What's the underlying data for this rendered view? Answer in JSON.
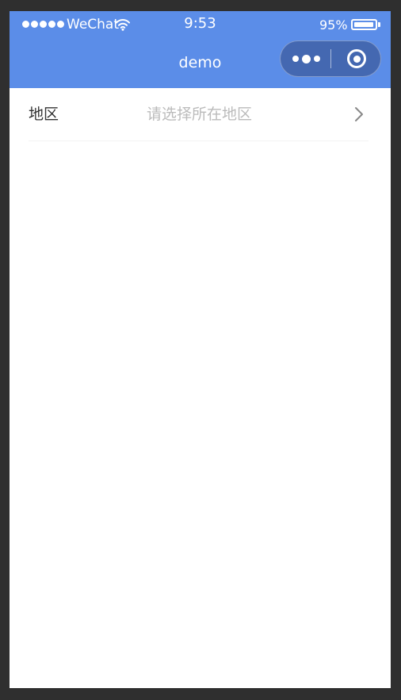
{
  "status_bar": {
    "carrier": "WeChat",
    "time": "9:53",
    "battery_percent": "95%",
    "battery_level": 0.95,
    "signal_dots": 5
  },
  "nav": {
    "title": "demo",
    "menu_icon": "more-dots-icon",
    "close_icon": "target-circle-icon"
  },
  "form": {
    "region_label": "地区",
    "region_placeholder": "请选择所在地区",
    "arrow_icon": "chevron-right-icon"
  },
  "colors": {
    "header_bg": "#5b8de8",
    "background": "#ffffff",
    "frame": "#2f2f2f",
    "label_text": "#333333",
    "placeholder_text": "#bbbbbb"
  }
}
